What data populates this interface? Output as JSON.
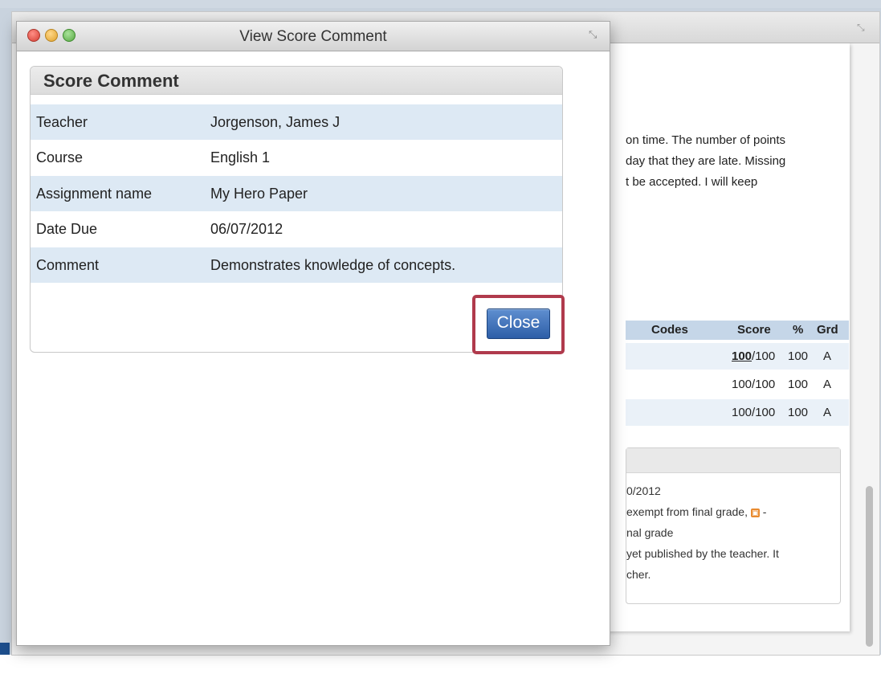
{
  "dialog": {
    "title": "View Score Comment",
    "panel_title": "Score Comment",
    "fields": [
      {
        "label": "Teacher",
        "value": "Jorgenson, James J"
      },
      {
        "label": "Course",
        "value": "English 1"
      },
      {
        "label": "Assignment name",
        "value": "My Hero Paper"
      },
      {
        "label": "Date Due",
        "value": "06/07/2012"
      },
      {
        "label": "Comment",
        "value": "Demonstrates knowledge of concepts."
      }
    ],
    "close_label": "Close"
  },
  "background": {
    "policy_lines": [
      "on time. The number of points",
      "day that they are late. Missing",
      "t be accepted. I will keep"
    ],
    "table": {
      "headers": {
        "codes": "Codes",
        "score": "Score",
        "percent": "%",
        "grade": "Grd"
      },
      "rows": [
        {
          "score_earned": "100",
          "score_total": "/100",
          "percent": "100",
          "grade": "A"
        },
        {
          "score": "100/100",
          "percent": "100",
          "grade": "A"
        },
        {
          "score": "100/100",
          "percent": "100",
          "grade": "A"
        }
      ]
    },
    "legend": {
      "date_fragment": "0/2012",
      "line1": "exempt from final grade,",
      "line1_suffix": "-",
      "line2": "nal grade",
      "line3": "yet published by the teacher. It",
      "line4": "cher."
    }
  },
  "colors": {
    "close_button": "#2d5ea7",
    "highlight_border": "#b03a4c",
    "row_shade": "#dde9f4",
    "table_header": "#c5d6e8"
  }
}
